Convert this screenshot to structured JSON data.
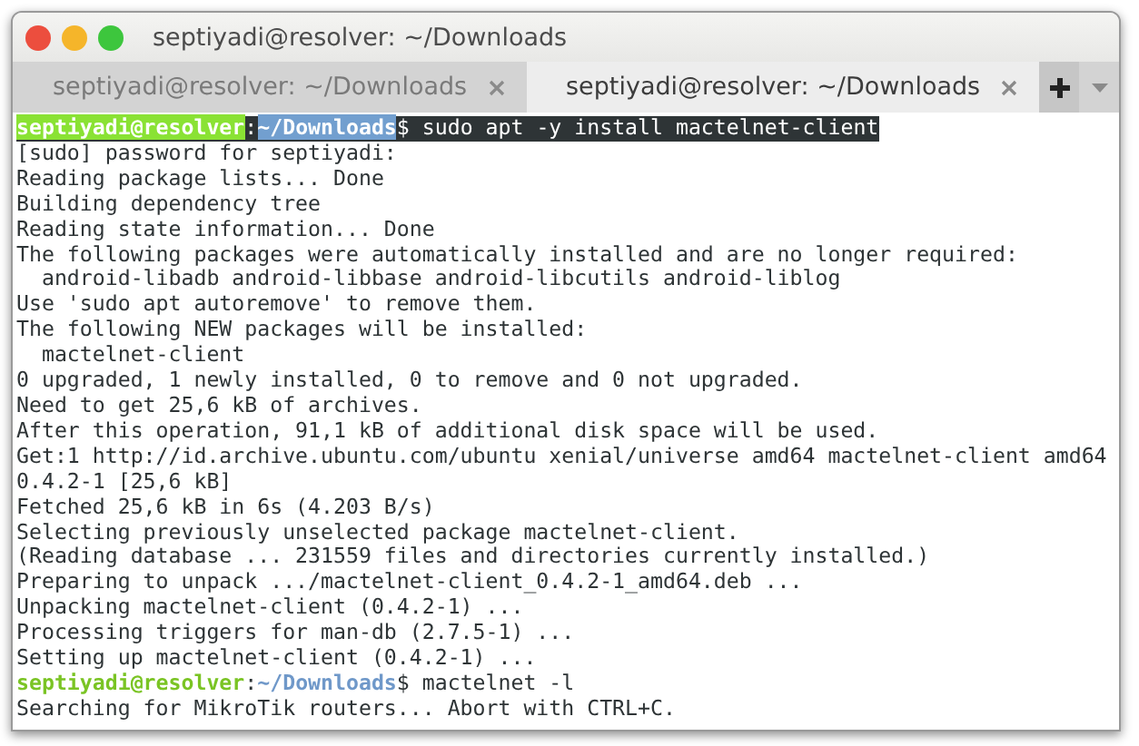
{
  "window": {
    "title": "septiyadi@resolver: ~/Downloads"
  },
  "tabs": [
    {
      "label": "septiyadi@resolver: ~/Downloads",
      "selected": false
    },
    {
      "label": "septiyadi@resolver: ~/Downloads",
      "selected": true
    }
  ],
  "terminal": {
    "lines": [
      {
        "kind": "prompt",
        "user": "septiyadi@resolver",
        "separator": ":",
        "path": "~/Downloads",
        "symbol": "$",
        "command": "sudo apt -y install mactelnet-client",
        "selected": true
      },
      {
        "kind": "output",
        "text": "[sudo] password for septiyadi:"
      },
      {
        "kind": "output",
        "text": "Reading package lists... Done"
      },
      {
        "kind": "output",
        "text": "Building dependency tree"
      },
      {
        "kind": "output",
        "text": "Reading state information... Done"
      },
      {
        "kind": "output",
        "text": "The following packages were automatically installed and are no longer required:"
      },
      {
        "kind": "output",
        "text": "  android-libadb android-libbase android-libcutils android-liblog"
      },
      {
        "kind": "output",
        "text": "Use 'sudo apt autoremove' to remove them."
      },
      {
        "kind": "output",
        "text": "The following NEW packages will be installed:"
      },
      {
        "kind": "output",
        "text": "  mactelnet-client"
      },
      {
        "kind": "output",
        "text": "0 upgraded, 1 newly installed, 0 to remove and 0 not upgraded."
      },
      {
        "kind": "output",
        "text": "Need to get 25,6 kB of archives."
      },
      {
        "kind": "output",
        "text": "After this operation, 91,1 kB of additional disk space will be used."
      },
      {
        "kind": "output",
        "text": "Get:1 http://id.archive.ubuntu.com/ubuntu xenial/universe amd64 mactelnet-client amd64"
      },
      {
        "kind": "output",
        "text": "0.4.2-1 [25,6 kB]"
      },
      {
        "kind": "output",
        "text": "Fetched 25,6 kB in 6s (4.203 B/s)"
      },
      {
        "kind": "output",
        "text": "Selecting previously unselected package mactelnet-client."
      },
      {
        "kind": "output",
        "text": "(Reading database ... 231559 files and directories currently installed.)"
      },
      {
        "kind": "output",
        "text": "Preparing to unpack .../mactelnet-client_0.4.2-1_amd64.deb ..."
      },
      {
        "kind": "output",
        "text": "Unpacking mactelnet-client (0.4.2-1) ..."
      },
      {
        "kind": "output",
        "text": "Processing triggers for man-db (2.7.5-1) ..."
      },
      {
        "kind": "output",
        "text": "Setting up mactelnet-client (0.4.2-1) ..."
      },
      {
        "kind": "prompt",
        "user": "septiyadi@resolver",
        "separator": ":",
        "path": "~/Downloads",
        "symbol": "$",
        "command": "mactelnet -l",
        "selected": false
      },
      {
        "kind": "output",
        "text": "Searching for MikroTik routers... Abort with CTRL+C."
      }
    ]
  }
}
